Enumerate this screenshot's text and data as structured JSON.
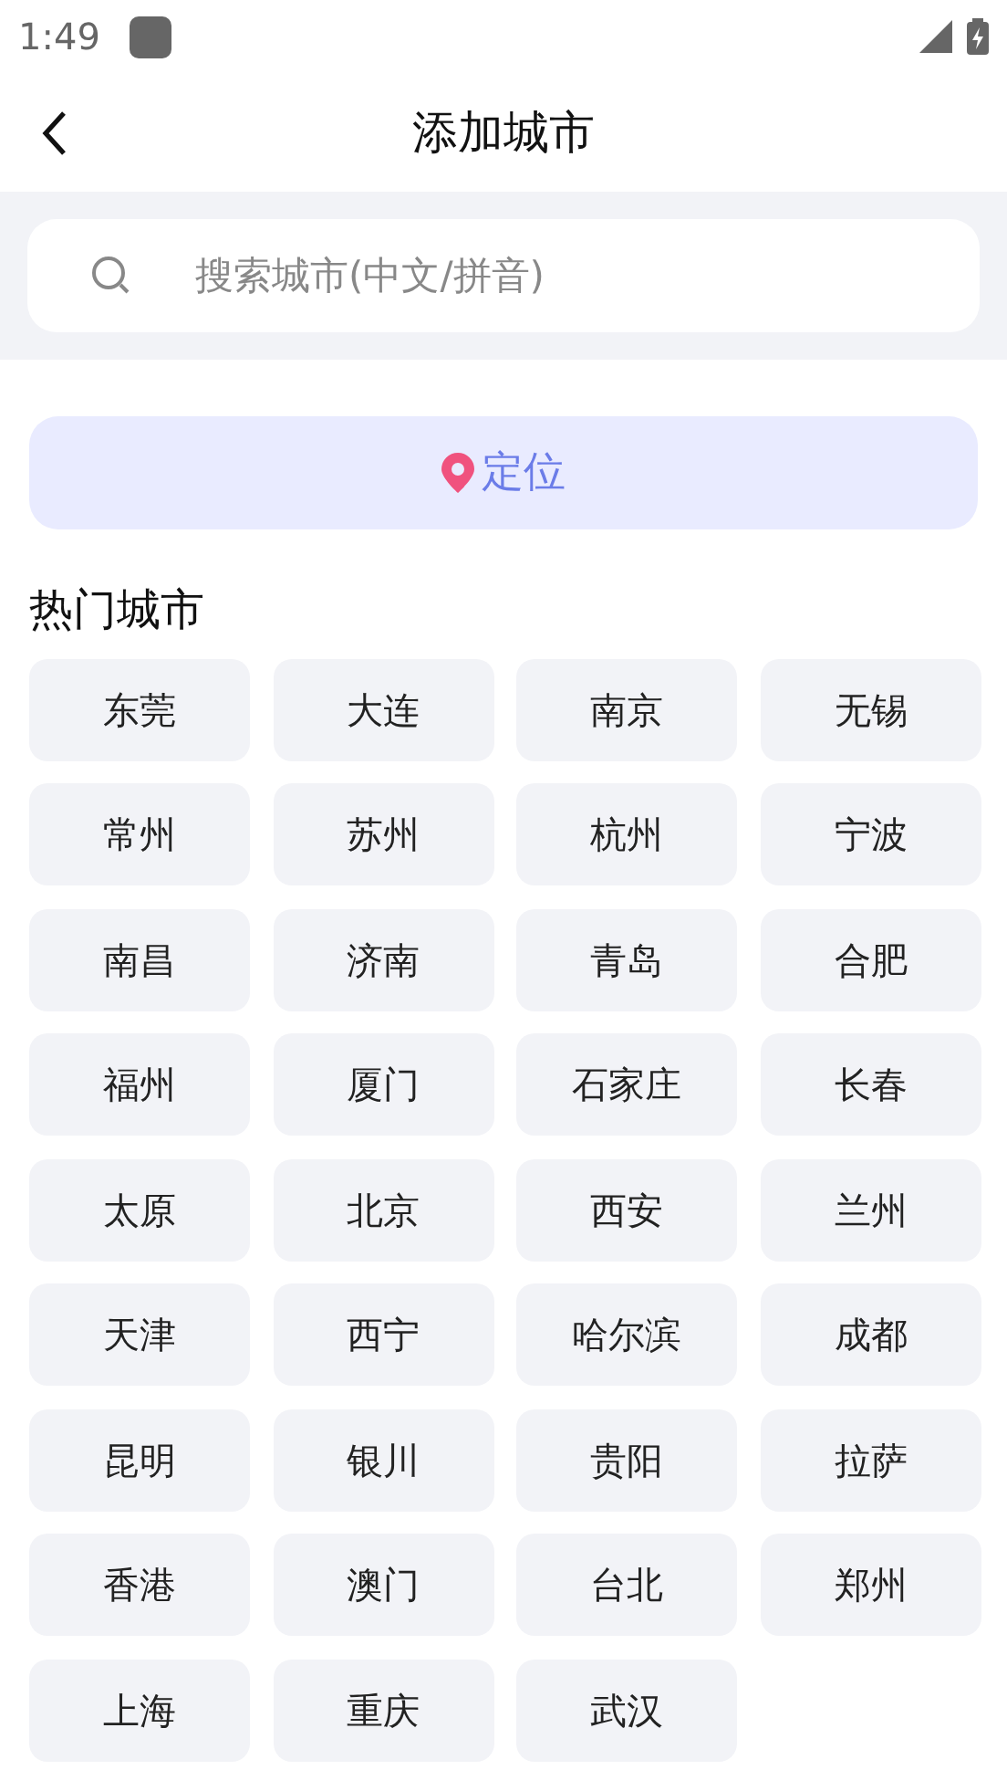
{
  "status_bar": {
    "time": "1:49"
  },
  "header": {
    "title": "添加城市"
  },
  "search": {
    "placeholder": "搜索城市(中文/拼音)"
  },
  "locate_button": {
    "label": "定位"
  },
  "hot_cities": {
    "title": "热门城市",
    "cities": [
      "东莞",
      "大连",
      "南京",
      "无锡",
      "常州",
      "苏州",
      "杭州",
      "宁波",
      "南昌",
      "济南",
      "青岛",
      "合肥",
      "福州",
      "厦门",
      "石家庄",
      "长春",
      "太原",
      "北京",
      "西安",
      "兰州",
      "天津",
      "西宁",
      "哈尔滨",
      "成都",
      "昆明",
      "银川",
      "贵阳",
      "拉萨",
      "香港",
      "澳门",
      "台北",
      "郑州",
      "上海",
      "重庆",
      "武汉"
    ]
  }
}
